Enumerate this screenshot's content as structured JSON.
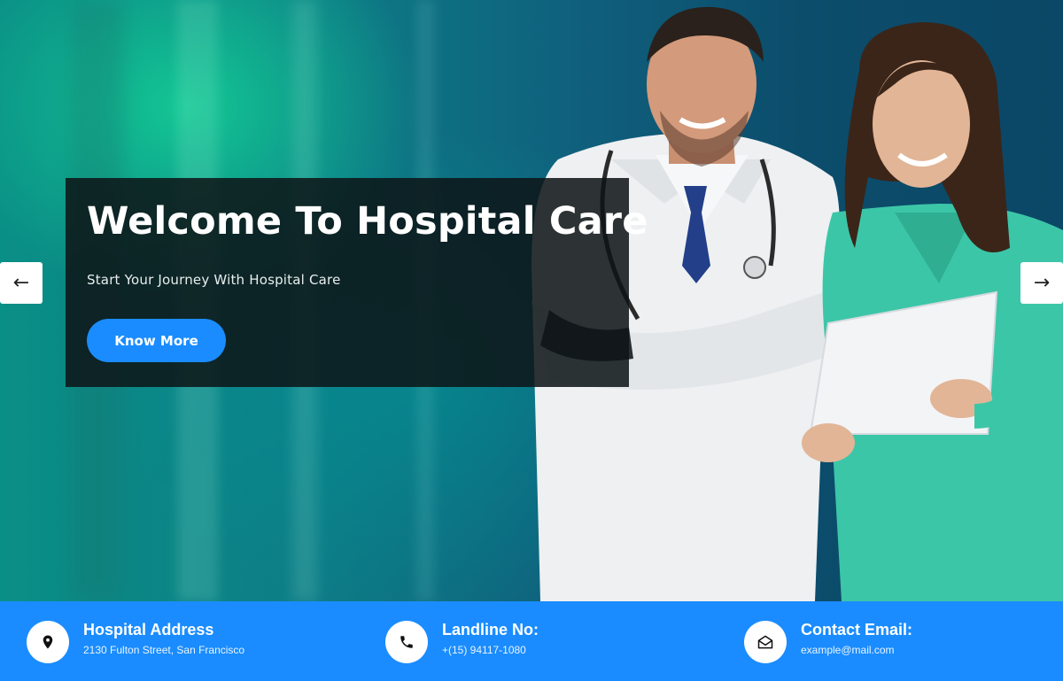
{
  "hero": {
    "title": "Welcome To Hospital Care",
    "subtitle": "Start Your Journey With Hospital Care",
    "cta_label": "Know More",
    "prev_arrow": "←",
    "next_arrow": "→"
  },
  "info": [
    {
      "icon": "location-pin-icon",
      "title": "Hospital Address",
      "detail": "2130 Fulton Street, San Francisco"
    },
    {
      "icon": "phone-icon",
      "title": "Landline No:",
      "detail": "+(15) 94117-1080"
    },
    {
      "icon": "envelope-open-icon",
      "title": "Contact Email:",
      "detail": "example@mail.com"
    }
  ],
  "colors": {
    "accent": "#1a8cff",
    "overlay": "#0d1416",
    "nurse_scrubs": "#3cc6a8"
  }
}
